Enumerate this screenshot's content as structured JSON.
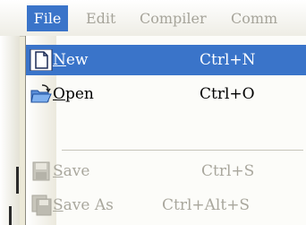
{
  "menubar": {
    "items": [
      {
        "label": "File"
      },
      {
        "label": "Edit"
      },
      {
        "label": "Compiler"
      },
      {
        "label": "Comm"
      }
    ]
  },
  "file_menu": {
    "items": [
      {
        "label": "New",
        "shortcut": "Ctrl+N",
        "icon": "new-document-icon",
        "state": "highlighted"
      },
      {
        "label": "Open",
        "shortcut": "Ctrl+O",
        "icon": "open-folder-icon",
        "state": "enabled"
      },
      {
        "label": "Save",
        "shortcut": "Ctrl+S",
        "icon": "save-disk-icon",
        "state": "disabled"
      },
      {
        "label": "Save As",
        "shortcut": "Ctrl+Alt+S",
        "icon": "save-as-disk-icon",
        "state": "disabled"
      }
    ]
  },
  "colors": {
    "highlight": "#3a74c9",
    "disabled_text": "#a9a79d",
    "menu_background": "#fcfcf9"
  }
}
